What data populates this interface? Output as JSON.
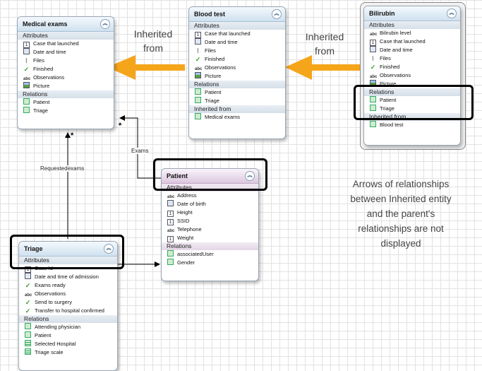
{
  "entities": {
    "medical_exams": {
      "title": "Medical exams",
      "attributes_label": "Attributes",
      "attributes": [
        "Case that launched",
        "Date and time",
        "Files",
        "Finished",
        "Observations",
        "Picture"
      ],
      "relations_label": "Relations",
      "relations": [
        "Patient",
        "Triage"
      ]
    },
    "blood_test": {
      "title": "Blood test",
      "attributes_label": "Attributes",
      "attributes": [
        "Case that launched",
        "Date and time",
        "Files",
        "Finished",
        "Observations",
        "Picture"
      ],
      "relations_label": "Relations",
      "relations": [
        "Patient",
        "Triage"
      ],
      "inherited_label": "Inherited from",
      "inherited": [
        "Medical exams"
      ]
    },
    "bilirubin": {
      "title": "Bilirubin",
      "attributes_label": "Attributes",
      "attributes": [
        "Bilirubin level",
        "Case that launched",
        "Date and time",
        "Files",
        "Finished",
        "Observations",
        "Picture"
      ],
      "relations_label": "Relations",
      "relations": [
        "Patient",
        "Triage"
      ],
      "inherited_label": "Inherited from",
      "inherited": [
        "Blood test"
      ]
    },
    "patient": {
      "title": "Patient",
      "attributes_label": "Attributes",
      "attributes": [
        "Address",
        "Date of birth",
        "Height",
        "SSID",
        "Telephone",
        "Weight"
      ],
      "relations_label": "Relations",
      "relations": [
        "associatedUser",
        "Gender"
      ]
    },
    "triage": {
      "title": "Triage",
      "attributes_label": "Attributes",
      "attributes": [
        "Case Id",
        "Date and time of admission",
        "Exams ready",
        "Observations",
        "Send to surgery",
        "Transfer to hospital confirmed"
      ],
      "relations_label": "Relations",
      "relations": [
        "Attending physician",
        "Patient",
        "Selected Hospital",
        "Triage scale"
      ]
    }
  },
  "icons": {
    "medical_exams": [
      "number-icon",
      "datetime-icon",
      "file-icon",
      "boolean-icon",
      "text-icon",
      "picture-icon"
    ],
    "bilirubin": [
      "text-icon",
      "number-icon",
      "datetime-icon",
      "file-icon",
      "boolean-icon",
      "text-icon",
      "picture-icon"
    ],
    "patient": [
      "text-icon",
      "datetime-icon",
      "number-icon",
      "number-icon",
      "text-icon",
      "number-icon"
    ],
    "triage": [
      "number-icon",
      "datetime-icon",
      "boolean-icon",
      "text-icon",
      "boolean-icon",
      "boolean-icon"
    ],
    "triage_relations": [
      "relation-icon",
      "relation-icon",
      "table-icon",
      "table-icon"
    ],
    "patient_relations": [
      "relation-icon",
      "relation-icon"
    ]
  },
  "labels": {
    "inherited_1": "Inherited from",
    "inherited_2": "Inherited from",
    "exams": "Exams",
    "requested_exams": "Requestedexams",
    "star_1": "*",
    "star_2": "*",
    "note": "Arrows of relationships between Inherited entity and the parent's relationships are not displayed"
  },
  "colors": {
    "inherit_arrow": "#f5a51a",
    "highlight": "#000000"
  }
}
